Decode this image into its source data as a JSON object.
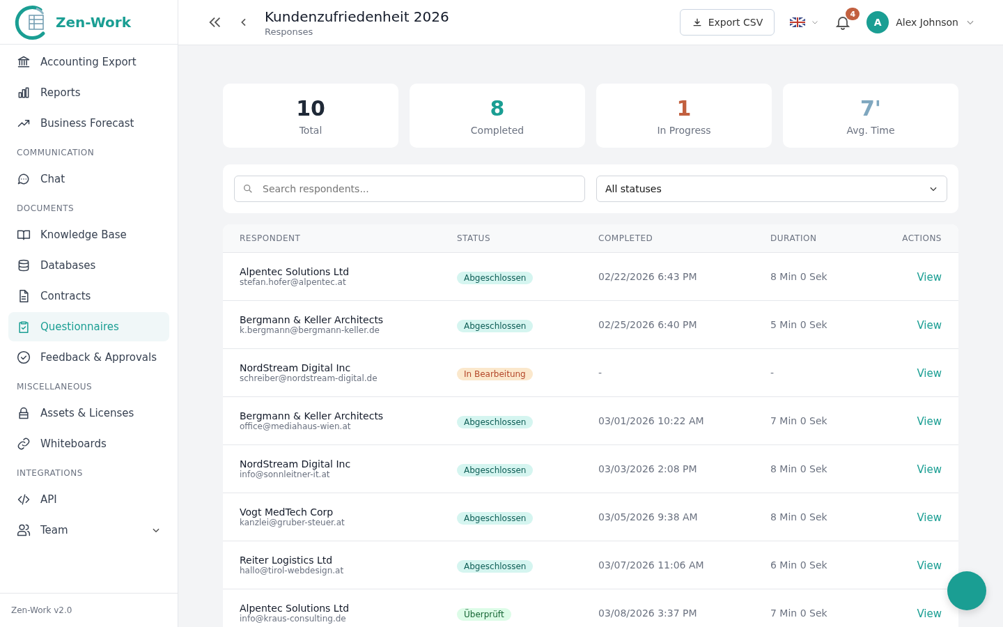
{
  "brand": {
    "name": "Zen-Work",
    "version": "Zen-Work v2.0"
  },
  "sidebar": {
    "groups": [
      {
        "items": [
          {
            "label": "Accounting Export",
            "selected": false
          },
          {
            "label": "Reports",
            "selected": false
          },
          {
            "label": "Business Forecast",
            "selected": false
          }
        ]
      },
      {
        "heading": "COMMUNICATION",
        "items": [
          {
            "label": "Chat",
            "selected": false
          }
        ]
      },
      {
        "heading": "DOCUMENTS",
        "items": [
          {
            "label": "Knowledge Base",
            "selected": false
          },
          {
            "label": "Databases",
            "selected": false
          },
          {
            "label": "Contracts",
            "selected": false
          },
          {
            "label": "Questionnaires",
            "selected": true
          },
          {
            "label": "Feedback & Approvals",
            "selected": false
          }
        ]
      },
      {
        "heading": "MISCELLANEOUS",
        "items": [
          {
            "label": "Assets & Licenses",
            "selected": false
          },
          {
            "label": "Whiteboards",
            "selected": false
          }
        ]
      },
      {
        "heading": "INTEGRATIONS",
        "items": [
          {
            "label": "API",
            "selected": false
          },
          {
            "label": "Team",
            "selected": false,
            "expanded": false
          }
        ]
      }
    ]
  },
  "header": {
    "title": "Kundenzufriedenheit 2026",
    "subtitle": "Responses",
    "export_button": "Export CSV",
    "notifications": "4",
    "user": {
      "initial": "A",
      "name": "Alex Johnson"
    }
  },
  "stats": [
    {
      "value": "10",
      "label": "Total",
      "color": "#1f2937"
    },
    {
      "value": "8",
      "label": "Completed",
      "color": "#1a9e93"
    },
    {
      "value": "1",
      "label": "In Progress",
      "color": "#c2603f"
    },
    {
      "value": "7'",
      "label": "Avg. Time",
      "color": "#7fa7bf"
    }
  ],
  "filters": {
    "search": {
      "placeholder": "Search respondents..."
    },
    "status": {
      "value": "All statuses"
    }
  },
  "table": {
    "columns": [
      "RESPONDENT",
      "STATUS",
      "COMPLETED",
      "DURATION",
      "ACTIONS"
    ],
    "rows": [
      {
        "name": "Alpentec Solutions Ltd",
        "email": "stefan.hofer@alpentec.at",
        "status": {
          "label": "Abgeschlossen",
          "kind": "completed"
        },
        "completed": "02/22/2026 6:43 PM",
        "duration": "8 Min 0 Sek",
        "action": "View"
      },
      {
        "name": "Bergmann & Keller Architects",
        "email": "k.bergmann@bergmann-keller.de",
        "status": {
          "label": "Abgeschlossen",
          "kind": "completed"
        },
        "completed": "02/25/2026 6:40 PM",
        "duration": "5 Min 0 Sek",
        "action": "View"
      },
      {
        "name": "NordStream Digital Inc",
        "email": "schreiber@nordstream-digital.de",
        "status": {
          "label": "In Bearbeitung",
          "kind": "in_progress"
        },
        "completed": "-",
        "duration": "-",
        "action": "View"
      },
      {
        "name": "Bergmann & Keller Architects",
        "email": "office@mediahaus-wien.at",
        "status": {
          "label": "Abgeschlossen",
          "kind": "completed"
        },
        "completed": "03/01/2026 10:22 AM",
        "duration": "7 Min 0 Sek",
        "action": "View"
      },
      {
        "name": "NordStream Digital Inc",
        "email": "info@sonnleitner-it.at",
        "status": {
          "label": "Abgeschlossen",
          "kind": "completed"
        },
        "completed": "03/03/2026 2:08 PM",
        "duration": "8 Min 0 Sek",
        "action": "View"
      },
      {
        "name": "Vogt MedTech Corp",
        "email": "kanzlei@gruber-steuer.at",
        "status": {
          "label": "Abgeschlossen",
          "kind": "completed"
        },
        "completed": "03/05/2026 9:38 AM",
        "duration": "8 Min 0 Sek",
        "action": "View"
      },
      {
        "name": "Reiter Logistics Ltd",
        "email": "hallo@tirol-webdesign.at",
        "status": {
          "label": "Abgeschlossen",
          "kind": "completed"
        },
        "completed": "03/07/2026 11:06 AM",
        "duration": "6 Min 0 Sek",
        "action": "View"
      },
      {
        "name": "Alpentec Solutions Ltd",
        "email": "info@kraus-consulting.de",
        "status": {
          "label": "Überprüft",
          "kind": "reviewed"
        },
        "completed": "03/08/2026 3:37 PM",
        "duration": "7 Min 0 Sek",
        "action": "View"
      }
    ]
  }
}
